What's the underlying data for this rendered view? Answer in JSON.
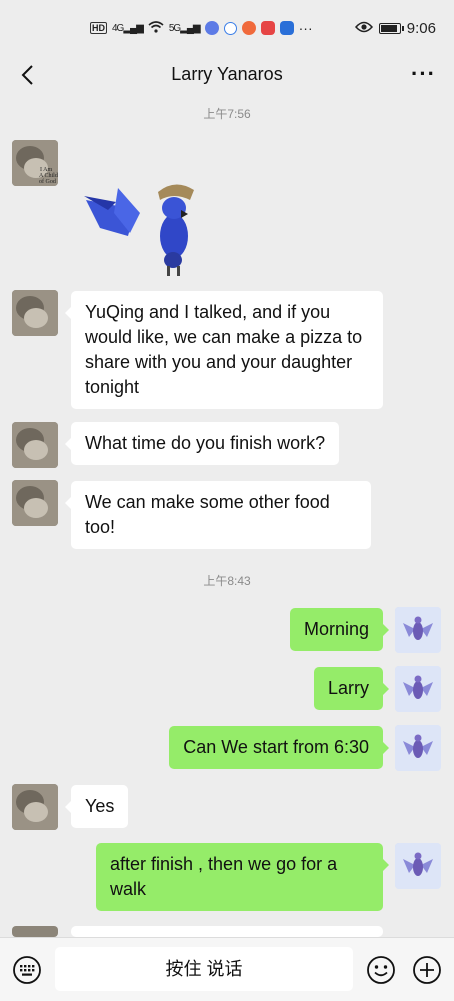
{
  "status_bar": {
    "time": "9:06",
    "network": "4G",
    "network2": "5G",
    "hd": "HD",
    "more": "···"
  },
  "header": {
    "title": "Larry Yanaros",
    "more": "···"
  },
  "messages": {
    "time1": "上午7:56",
    "m1": "YuQing and I talked, and if you would like, we can make a pizza to share with you and your daughter tonight",
    "m2": "What time do you finish work?",
    "m3": "We can make some other food too!",
    "time2": "上午8:43",
    "m4": "Morning",
    "m5": "Larry",
    "m6": "Can We start from 6:30",
    "m7": "Yes",
    "m8": "after finish , then we go for a walk"
  },
  "avatar_text": {
    "line1": "I Am",
    "line2": "A Child",
    "line3": "of God"
  },
  "input_bar": {
    "voice_label": "按住 说话"
  },
  "colors": {
    "background": "#ededed",
    "outgoing_bubble": "#95ec69",
    "incoming_bubble": "#ffffff"
  }
}
